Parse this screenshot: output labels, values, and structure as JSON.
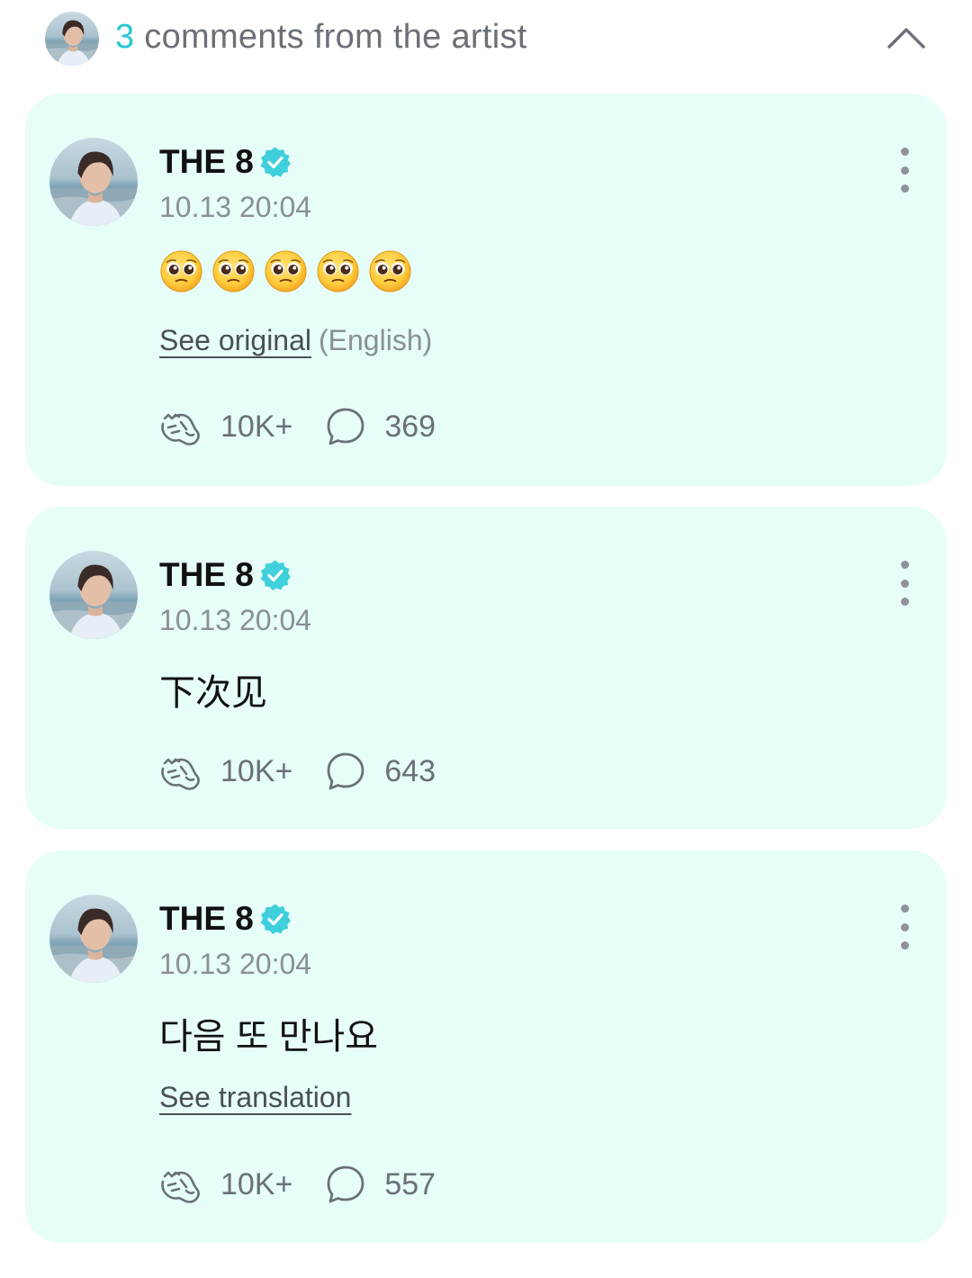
{
  "header": {
    "count": "3",
    "title_rest": " comments from the artist",
    "collapse_icon": "chevron-up-icon"
  },
  "comments": [
    {
      "author": "THE 8",
      "verified": true,
      "time": "10.13 20:04",
      "emoji_count": 5,
      "emoji_name": "pleading-face",
      "link_label": "See original",
      "link_suffix": "(English)",
      "cheers": "10K+",
      "replies": "369"
    },
    {
      "author": "THE 8",
      "verified": true,
      "time": "10.13 20:04",
      "text": "下次见",
      "cheers": "10K+",
      "replies": "643"
    },
    {
      "author": "THE 8",
      "verified": true,
      "time": "10.13 20:04",
      "text": "다음 또 만나요",
      "link_label": "See translation",
      "cheers": "10K+",
      "replies": "557"
    }
  ],
  "colors": {
    "accent": "#29c6d4",
    "card_bg": "#e6fdf8",
    "verified": "#3fd0dc",
    "muted": "#8a8f96"
  }
}
